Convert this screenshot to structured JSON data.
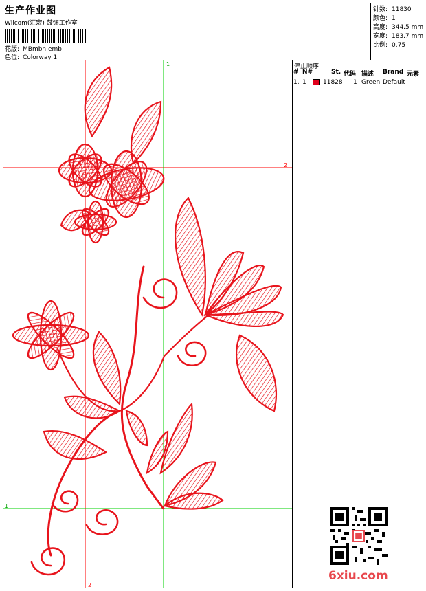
{
  "title": "生产作业图",
  "company": "Wilcom(汇宏) 鼓饰工作室",
  "design": {
    "label": "花版:",
    "value": "MBmbn.emb"
  },
  "colorway": {
    "label": "色位:",
    "value": "Colorway 1"
  },
  "stats": [
    {
      "label": "针数:",
      "value": "11830"
    },
    {
      "label": "颜色:",
      "value": "1"
    },
    {
      "label": "高度:",
      "value": "344.5 mm"
    },
    {
      "label": "宽度:",
      "value": "183.7 mm"
    },
    {
      "label": "比例:",
      "value": "0.75"
    }
  ],
  "sequence": {
    "title": "停止顺序:",
    "headers": {
      "num": "#",
      "n": "N#",
      "stitches": "St.",
      "code": "代码",
      "desc": "描述",
      "brand": "Brand",
      "elements": "元素"
    },
    "rows": [
      {
        "num": "1.",
        "n": "1",
        "color": "#e0001b",
        "stitches": "11828",
        "code": "1",
        "desc": "Green",
        "brand": "Default"
      }
    ]
  },
  "guides": {
    "red_v": "2",
    "red_h": "2",
    "green_v": "1",
    "green_h": "1",
    "red_color": "#ff0000",
    "green_color": "#00d000"
  },
  "embroidery_color": "#e8141c",
  "watermark": "6xiu.com"
}
